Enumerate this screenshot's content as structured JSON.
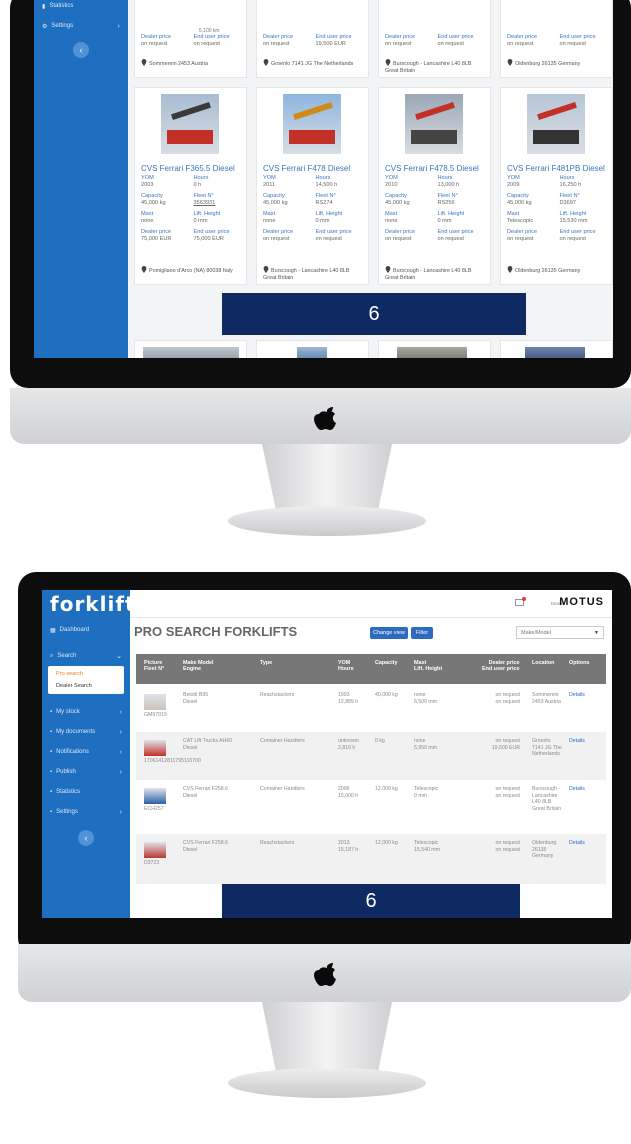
{
  "colors": {
    "sidebar": "#1e6fc0",
    "overlay": "#0f2a63",
    "link": "#3a76c1",
    "table_header": "#777777"
  },
  "top": {
    "sidebar": {
      "items": [
        {
          "label": "Statistics",
          "icon": "bar-chart-icon"
        },
        {
          "label": "Settings",
          "icon": "gear-icon"
        }
      ],
      "toggle_icon": "chevron-left-icon"
    },
    "partial_cards": [
      {
        "hours_partial": "5,100 km",
        "dealer_label": "Dealer price",
        "dealer": "on request",
        "end_label": "End user price",
        "end": "on request",
        "location": "Sommerein 2453 Austria"
      },
      {
        "dealer_label": "Dealer price",
        "dealer": "on request",
        "end_label": "End user price",
        "end": "19,500 EUR",
        "location": "Groenlo 7141 JG The Netherlands"
      },
      {
        "dealer_label": "Dealer price",
        "dealer": "on request",
        "end_label": "End user price",
        "end": "on request",
        "location": "Burscough - Lancashire L40 8LB Great Britain"
      },
      {
        "dealer_label": "Dealer price",
        "dealer": "on request",
        "end_label": "End user price",
        "end": "on request",
        "location": "Oldenburg 26135 Germany"
      }
    ],
    "cards": [
      {
        "title": "CVS Ferrari F365.5 Diesel",
        "yom_label": "YOM",
        "yom": "2003",
        "hours_label": "Hours",
        "hours": "0 h",
        "capacity_label": "Capacity",
        "capacity": "45,000 kg",
        "fleet_label": "Fleet N°",
        "fleet": "3563931",
        "mast_label": "Mast",
        "mast": "none",
        "lift_label": "Lift. Height",
        "lift": "0 mm",
        "dealer_label": "Dealer price",
        "dealer": "75,000 EUR",
        "end_label": "End user price",
        "end": "75,000 EUR",
        "location": "Pomigliano d'Arco (NA) 80038 Italy"
      },
      {
        "title": "CVS Ferrari F478 Diesel",
        "yom_label": "YOM",
        "yom": "2011",
        "hours_label": "Hours",
        "hours": "14,500 h",
        "capacity_label": "Capacity",
        "capacity": "45,000 kg",
        "fleet_label": "Fleet N°",
        "fleet": "RS274",
        "mast_label": "Mast",
        "mast": "none",
        "lift_label": "Lift. Height",
        "lift": "0 mm",
        "dealer_label": "Dealer price",
        "dealer": "on request",
        "end_label": "End user price",
        "end": "on request",
        "location": "Burscough - Lancashire L40 8LB Great Britain"
      },
      {
        "title": "CVS Ferrari F478.5 Diesel",
        "yom_label": "YOM",
        "yom": "2010",
        "hours_label": "Hours",
        "hours": "13,000 h",
        "capacity_label": "Capacity",
        "capacity": "45,000 kg",
        "fleet_label": "Fleet N°",
        "fleet": "RS256",
        "mast_label": "Mast",
        "mast": "none",
        "lift_label": "Lift. Height",
        "lift": "0 mm",
        "dealer_label": "Dealer price",
        "dealer": "on request",
        "end_label": "End user price",
        "end": "on request",
        "location": "Burscough - Lancashire L40 8LB Great Britain"
      },
      {
        "title": "CVS Ferrari F481PB Diesel",
        "yom_label": "YOM",
        "yom": "2009",
        "hours_label": "Hours",
        "hours": "16,250 h",
        "capacity_label": "Capacity",
        "capacity": "45,000 kg",
        "fleet_label": "Fleet N°",
        "fleet": "D3697",
        "mast_label": "Mast",
        "mast": "Telescopic",
        "lift_label": "Lift. Height",
        "lift": "15,530 mm",
        "dealer_label": "Dealer price",
        "dealer": "on request",
        "end_label": "End user price",
        "end": "on request",
        "location": "Oldenburg 26135 Germany"
      }
    ],
    "overlay_number": "6"
  },
  "bottom": {
    "logo": "forklift",
    "page_title": "PRO SEARCH FORKLIFTS",
    "change_view": "Change view",
    "filter": "Filter",
    "sort_select": "Make/Model",
    "dealer_label": "Dealer",
    "brand": "MOTUS",
    "sidebar": {
      "dashboard": "Dashboard",
      "search": "Search",
      "sub": [
        "Pro search",
        "Dealer Search"
      ],
      "items": [
        {
          "label": "My stock",
          "icon": "stock-icon"
        },
        {
          "label": "My documents",
          "icon": "documents-icon"
        },
        {
          "label": "Notifications",
          "icon": "bell-icon"
        },
        {
          "label": "Publish",
          "icon": "publish-icon"
        },
        {
          "label": "Statistics",
          "icon": "bar-chart-icon"
        },
        {
          "label": "Settings",
          "icon": "gear-icon"
        }
      ]
    },
    "columns": [
      "Picture",
      "Fleet N°",
      "Make Model",
      "Engine",
      "Type",
      "YOM",
      "Hours",
      "Capacity",
      "Mast",
      "Lift. Height",
      "Dealer price",
      "End user price",
      "Location",
      "Options"
    ],
    "rows": [
      {
        "fleet": "GM97019",
        "model": "Belotti B95",
        "engine": "Diesel",
        "type": "Reachstackers",
        "yom": "1993",
        "hours": "12,889 h",
        "capacity": "40,000 kg",
        "mast": "none",
        "lift": "6,500 mm",
        "dealer": "on request",
        "end": "on request",
        "location": "Sommerein 2453 Austria",
        "option": "Details"
      },
      {
        "fleet": "17061412811795110700",
        "model": "CAT Lift Trucks AH60",
        "engine": "Diesel",
        "type": "Container Handlers",
        "yom": "unknown",
        "hours": "2,810 h",
        "capacity": "0 kg",
        "mast": "none",
        "lift": "5,950 mm",
        "dealer": "on request",
        "end": "19,500 EUR",
        "location": "Groenlo 7141 JG The Netherlands",
        "option": "Details"
      },
      {
        "fleet": "ECH257",
        "model": "CVS Ferrari F258.6",
        "engine": "Diesel",
        "type": "Container Handlers",
        "yom": "2006",
        "hours": "15,000 h",
        "capacity": "12,000 kg",
        "mast": "Telescopic",
        "lift": "0 mm",
        "dealer": "on request",
        "end": "on request",
        "location": "Burscough - Lancashire L40 8LB Great Britain",
        "option": "Details"
      },
      {
        "fleet": "D3723",
        "model": "CVS Ferrari F258.6",
        "engine": "Diesel",
        "type": "Reachstackers",
        "yom": "2013",
        "hours": "15,187 h",
        "capacity": "12,000 kg",
        "mast": "Telescopic",
        "lift": "15,540 mm",
        "dealer": "on request",
        "end": "on request",
        "location": "Oldenburg 26135 Germany",
        "option": "Details"
      }
    ],
    "overlay_number": "6"
  }
}
